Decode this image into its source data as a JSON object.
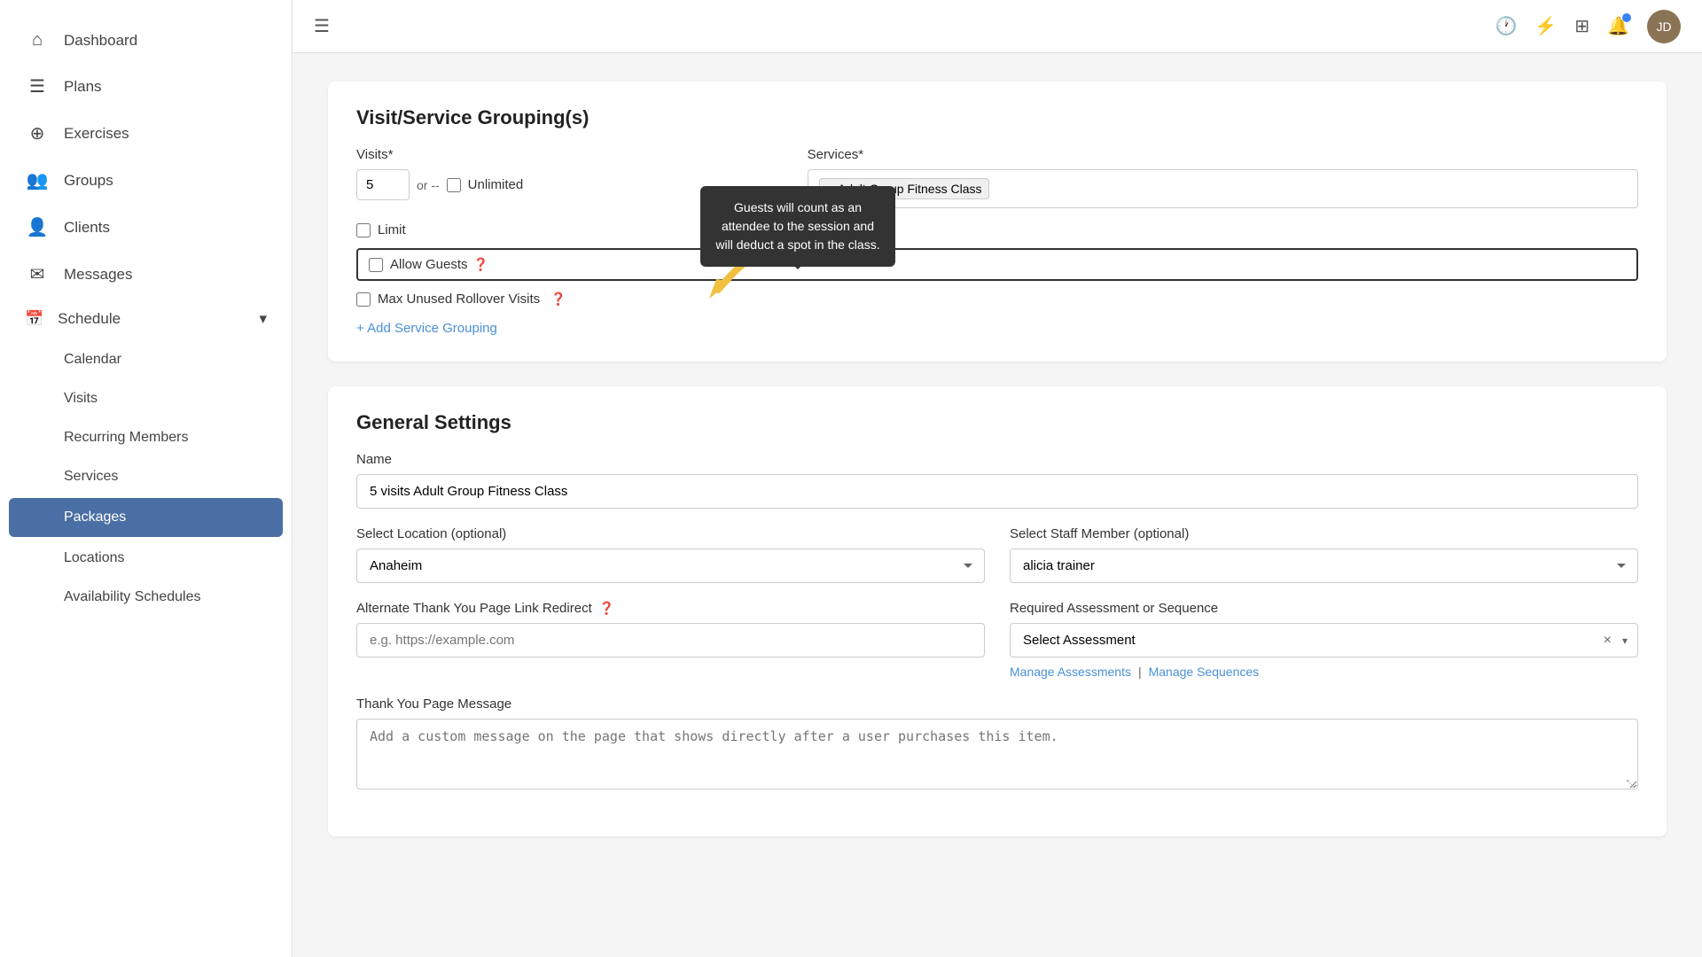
{
  "sidebar": {
    "items": [
      {
        "id": "dashboard",
        "label": "Dashboard",
        "icon": "⊞"
      },
      {
        "id": "plans",
        "label": "Plans",
        "icon": "📋"
      },
      {
        "id": "exercises",
        "label": "Exercises",
        "icon": "🏋"
      },
      {
        "id": "groups",
        "label": "Groups",
        "icon": "👥"
      },
      {
        "id": "clients",
        "label": "Clients",
        "icon": "👤"
      },
      {
        "id": "messages",
        "label": "Messages",
        "icon": "✉"
      },
      {
        "id": "schedule",
        "label": "Schedule",
        "icon": "📅",
        "has_dropdown": true
      },
      {
        "id": "calendar",
        "label": "Calendar",
        "indent": true
      },
      {
        "id": "visits",
        "label": "Visits",
        "indent": true
      },
      {
        "id": "recurring-members",
        "label": "Recurring Members",
        "indent": true
      },
      {
        "id": "services",
        "label": "Services",
        "indent": true
      },
      {
        "id": "packages",
        "label": "Packages",
        "indent": true,
        "active": true
      },
      {
        "id": "locations",
        "label": "Locations",
        "indent": true
      },
      {
        "id": "availability-schedules",
        "label": "Availability Schedules",
        "indent": true
      }
    ]
  },
  "topbar": {
    "menu_icon": "☰",
    "history_icon": "🕐",
    "lightning_icon": "⚡",
    "grid_icon": "⊞",
    "bell_icon": "🔔",
    "avatar_text": "JD"
  },
  "visit_service_grouping": {
    "section_title": "Visit/Service Grouping(s)",
    "visits_label": "Visits*",
    "visits_value": "5",
    "or_label": "or --",
    "unlimited_label": "Unlimited",
    "services_label": "Services*",
    "service_tag": "× Adult Group Fitness Class",
    "limit_checkbox": "Limit",
    "allow_guests_label": "Allow Guests",
    "max_rollover_label": "Max Unused Rollover Visits",
    "add_grouping_label": "+ Add Service Grouping",
    "tooltip_text": "Guests will count as an attendee to the session and will deduct a spot in the class."
  },
  "general_settings": {
    "section_title": "General Settings",
    "name_label": "Name",
    "name_value": "5 visits Adult Group Fitness Class",
    "location_label": "Select Location (optional)",
    "location_value": "Anaheim",
    "location_placeholder": "Anaheim",
    "staff_label": "Select Staff Member (optional)",
    "staff_value": "alicia trainer",
    "alt_thank_you_label": "Alternate Thank You Page Link Redirect",
    "alt_thank_you_placeholder": "e.g. https://example.com",
    "assessment_label": "Required Assessment or Sequence",
    "assessment_placeholder": "Select Assessment",
    "manage_assessments": "Manage Assessments",
    "manage_sequences": "Manage Sequences",
    "thank_you_label": "Thank You Page Message",
    "thank_you_placeholder": "Add a custom message on the page that shows directly after a user purchases this item."
  }
}
